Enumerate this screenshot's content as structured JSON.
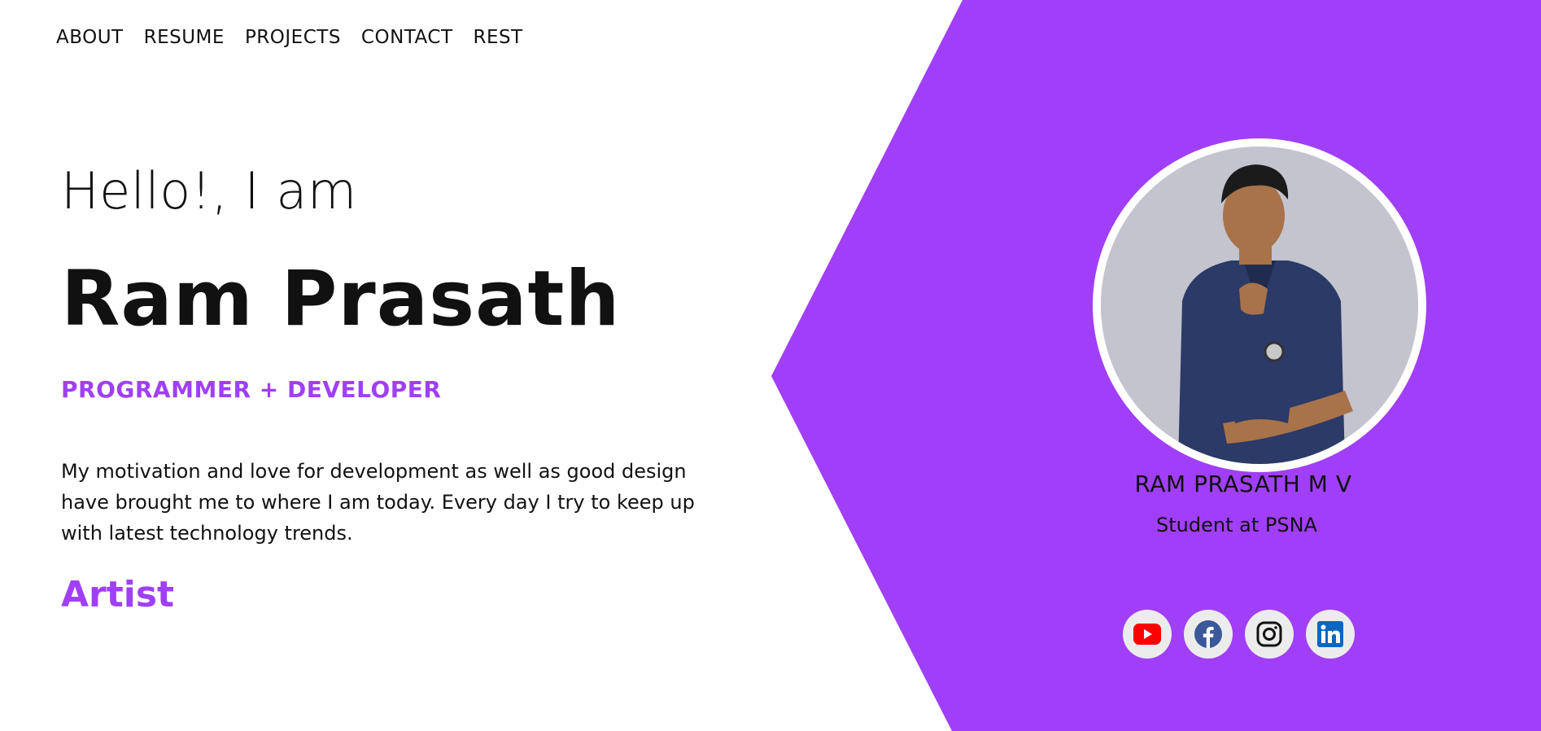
{
  "nav": {
    "items": [
      {
        "label": "ABOUT"
      },
      {
        "label": "RESUME"
      },
      {
        "label": "PROJECTS"
      },
      {
        "label": "CONTACT"
      },
      {
        "label": "REST"
      }
    ]
  },
  "hero": {
    "greeting": "Hello!, I am",
    "name": "Ram Prasath",
    "tagline": "PROGRAMMER + DEVELOPER",
    "bio": "My motivation and love for development as well as good design have brought me to where I am today. Every day I try to keep up with latest technology trends.",
    "role": "Artist"
  },
  "profile_card": {
    "name": "RAM PRASATH M V",
    "subtitle": "Student at PSNA",
    "photo_icon": "profile-photo"
  },
  "socials": [
    {
      "icon": "youtube-icon"
    },
    {
      "icon": "facebook-icon"
    },
    {
      "icon": "instagram-icon"
    },
    {
      "icon": "linkedin-icon"
    }
  ],
  "colors": {
    "accent": "#a03ff7",
    "text": "#111111",
    "background": "#ffffff",
    "youtube": "#ff0000",
    "facebook": "#3b5998",
    "linkedin": "#0a66c2"
  }
}
